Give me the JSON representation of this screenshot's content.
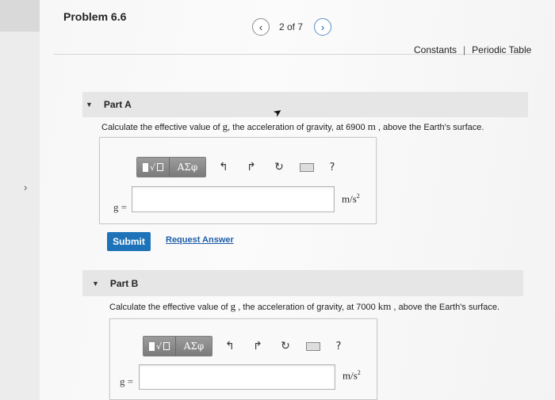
{
  "problem": {
    "title": "Problem 6.6"
  },
  "pager": {
    "prev_icon": "‹",
    "count": "2 of 7",
    "next_icon": "›"
  },
  "top_links": {
    "constants": "Constants",
    "separator": "|",
    "periodic_table": "Periodic Table"
  },
  "side": {
    "chevron": "›"
  },
  "part_a": {
    "label": "Part A",
    "question_pre": "Calculate the effective value of ",
    "question_var": "g",
    "question_mid": ", the acceleration of gravity, at 6900 ",
    "question_unit": "m",
    "question_post": " , above the Earth's surface.",
    "eq_label": "g =",
    "unit": "m/s",
    "unit_exp": "2",
    "submit_label": "Submit",
    "request_label": "Request Answer"
  },
  "part_b": {
    "label": "Part B",
    "question_pre": "Calculate the effective value of ",
    "question_var": "g",
    "question_mid": " , the acceleration of gravity, at 7000 ",
    "question_unit": "km",
    "question_post": " , above the Earth's surface.",
    "eq_label": "g =",
    "unit": "m/s",
    "unit_exp": "2"
  },
  "toolbar": {
    "greek_label": "ΑΣφ",
    "radical_glyph": "√",
    "undo_icon": "↰",
    "redo_icon": "↱",
    "reset_icon": "↻",
    "help_label": "?"
  },
  "colors": {
    "accent": "#1e73b8",
    "link": "#1e5fa8",
    "toolbar": "#8a8a8a"
  }
}
